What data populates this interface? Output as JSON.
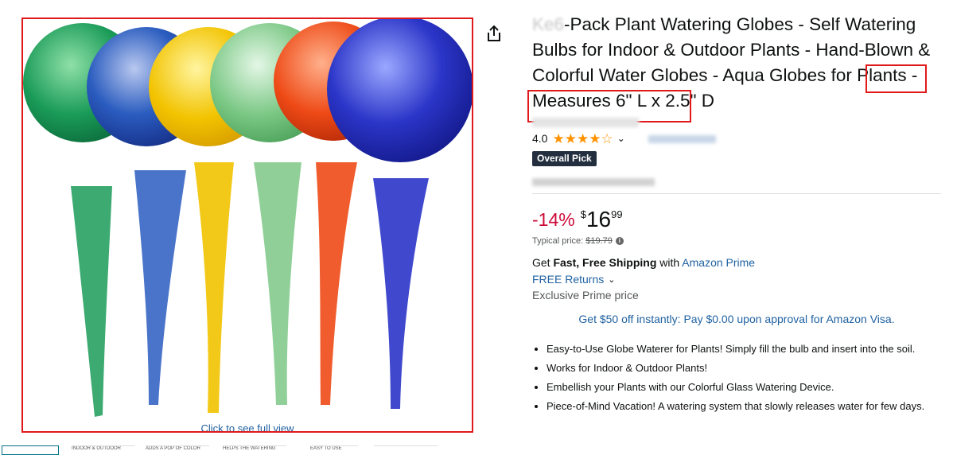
{
  "gallery": {
    "click_full_label": "Click to see full view",
    "globes": [
      {
        "color": "green",
        "hex": "#1a9b58"
      },
      {
        "color": "blue",
        "hex": "#2a5cbf"
      },
      {
        "color": "yellow",
        "hex": "#f2c300"
      },
      {
        "color": "light green",
        "hex": "#7cc886"
      },
      {
        "color": "orange",
        "hex": "#ee4a16"
      },
      {
        "color": "blue",
        "hex": "#2b35c8"
      }
    ],
    "thumbnails": [
      "INDOOR & OUTDOOR",
      "ADDS A POP OF COLOR",
      "HELPS THE WATERING",
      "EASY TO USE",
      ""
    ]
  },
  "share_icon": "share-icon",
  "product": {
    "title_prefix_blurred": "Ke",
    "title_blur_mid": "6",
    "title_part1": "-Pack Plant Watering Globes - Self Watering Bulbs for Indoor & Outdoor Plants - Hand-Blown & Colorful Water Globes - ",
    "title_highlight": "Aqua Globes for Plants",
    "title_part2": " - Measures 6\" L x 2.5\" D",
    "rating_value": "4.0",
    "stars_filled": 4,
    "stars_total": 5,
    "badge": "Overall Pick"
  },
  "pricing": {
    "discount": "-14%",
    "currency": "$",
    "price_whole": "16",
    "price_fraction": "99",
    "typical_label": "Typical price:",
    "typical_value": "$19.79"
  },
  "shipping": {
    "get": "Get ",
    "fast_free": "Fast, Free Shipping",
    "with": " with ",
    "prime_link": "Amazon Prime",
    "returns": "FREE Returns",
    "exclusive": "Exclusive Prime price",
    "visa_offer": "Get $50 off instantly: Pay $0.00 upon approval for Amazon Visa."
  },
  "bullets": [
    "Easy-to-Use Globe Waterer for Plants! Simply fill the bulb and insert into the soil.",
    "Works for Indoor & Outdoor Plants!",
    "Embellish your Plants with our Colorful Glass Watering Device.",
    "Piece-of-Mind Vacation! A watering system that slowly releases water for few days."
  ],
  "colors": {
    "highlight_border": "#e0191a",
    "link": "#2162a1",
    "discount": "#cc0c39",
    "star": "#ff9200",
    "badge_bg": "#232f3e"
  }
}
